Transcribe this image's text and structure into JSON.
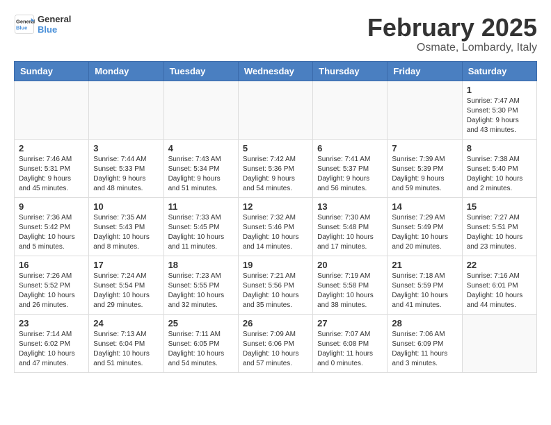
{
  "header": {
    "logo_general": "General",
    "logo_blue": "Blue",
    "month_title": "February 2025",
    "location": "Osmate, Lombardy, Italy"
  },
  "weekdays": [
    "Sunday",
    "Monday",
    "Tuesday",
    "Wednesday",
    "Thursday",
    "Friday",
    "Saturday"
  ],
  "weeks": [
    [
      {
        "day": "",
        "info": ""
      },
      {
        "day": "",
        "info": ""
      },
      {
        "day": "",
        "info": ""
      },
      {
        "day": "",
        "info": ""
      },
      {
        "day": "",
        "info": ""
      },
      {
        "day": "",
        "info": ""
      },
      {
        "day": "1",
        "info": "Sunrise: 7:47 AM\nSunset: 5:30 PM\nDaylight: 9 hours and 43 minutes."
      }
    ],
    [
      {
        "day": "2",
        "info": "Sunrise: 7:46 AM\nSunset: 5:31 PM\nDaylight: 9 hours and 45 minutes."
      },
      {
        "day": "3",
        "info": "Sunrise: 7:44 AM\nSunset: 5:33 PM\nDaylight: 9 hours and 48 minutes."
      },
      {
        "day": "4",
        "info": "Sunrise: 7:43 AM\nSunset: 5:34 PM\nDaylight: 9 hours and 51 minutes."
      },
      {
        "day": "5",
        "info": "Sunrise: 7:42 AM\nSunset: 5:36 PM\nDaylight: 9 hours and 54 minutes."
      },
      {
        "day": "6",
        "info": "Sunrise: 7:41 AM\nSunset: 5:37 PM\nDaylight: 9 hours and 56 minutes."
      },
      {
        "day": "7",
        "info": "Sunrise: 7:39 AM\nSunset: 5:39 PM\nDaylight: 9 hours and 59 minutes."
      },
      {
        "day": "8",
        "info": "Sunrise: 7:38 AM\nSunset: 5:40 PM\nDaylight: 10 hours and 2 minutes."
      }
    ],
    [
      {
        "day": "9",
        "info": "Sunrise: 7:36 AM\nSunset: 5:42 PM\nDaylight: 10 hours and 5 minutes."
      },
      {
        "day": "10",
        "info": "Sunrise: 7:35 AM\nSunset: 5:43 PM\nDaylight: 10 hours and 8 minutes."
      },
      {
        "day": "11",
        "info": "Sunrise: 7:33 AM\nSunset: 5:45 PM\nDaylight: 10 hours and 11 minutes."
      },
      {
        "day": "12",
        "info": "Sunrise: 7:32 AM\nSunset: 5:46 PM\nDaylight: 10 hours and 14 minutes."
      },
      {
        "day": "13",
        "info": "Sunrise: 7:30 AM\nSunset: 5:48 PM\nDaylight: 10 hours and 17 minutes."
      },
      {
        "day": "14",
        "info": "Sunrise: 7:29 AM\nSunset: 5:49 PM\nDaylight: 10 hours and 20 minutes."
      },
      {
        "day": "15",
        "info": "Sunrise: 7:27 AM\nSunset: 5:51 PM\nDaylight: 10 hours and 23 minutes."
      }
    ],
    [
      {
        "day": "16",
        "info": "Sunrise: 7:26 AM\nSunset: 5:52 PM\nDaylight: 10 hours and 26 minutes."
      },
      {
        "day": "17",
        "info": "Sunrise: 7:24 AM\nSunset: 5:54 PM\nDaylight: 10 hours and 29 minutes."
      },
      {
        "day": "18",
        "info": "Sunrise: 7:23 AM\nSunset: 5:55 PM\nDaylight: 10 hours and 32 minutes."
      },
      {
        "day": "19",
        "info": "Sunrise: 7:21 AM\nSunset: 5:56 PM\nDaylight: 10 hours and 35 minutes."
      },
      {
        "day": "20",
        "info": "Sunrise: 7:19 AM\nSunset: 5:58 PM\nDaylight: 10 hours and 38 minutes."
      },
      {
        "day": "21",
        "info": "Sunrise: 7:18 AM\nSunset: 5:59 PM\nDaylight: 10 hours and 41 minutes."
      },
      {
        "day": "22",
        "info": "Sunrise: 7:16 AM\nSunset: 6:01 PM\nDaylight: 10 hours and 44 minutes."
      }
    ],
    [
      {
        "day": "23",
        "info": "Sunrise: 7:14 AM\nSunset: 6:02 PM\nDaylight: 10 hours and 47 minutes."
      },
      {
        "day": "24",
        "info": "Sunrise: 7:13 AM\nSunset: 6:04 PM\nDaylight: 10 hours and 51 minutes."
      },
      {
        "day": "25",
        "info": "Sunrise: 7:11 AM\nSunset: 6:05 PM\nDaylight: 10 hours and 54 minutes."
      },
      {
        "day": "26",
        "info": "Sunrise: 7:09 AM\nSunset: 6:06 PM\nDaylight: 10 hours and 57 minutes."
      },
      {
        "day": "27",
        "info": "Sunrise: 7:07 AM\nSunset: 6:08 PM\nDaylight: 11 hours and 0 minutes."
      },
      {
        "day": "28",
        "info": "Sunrise: 7:06 AM\nSunset: 6:09 PM\nDaylight: 11 hours and 3 minutes."
      },
      {
        "day": "",
        "info": ""
      }
    ]
  ]
}
